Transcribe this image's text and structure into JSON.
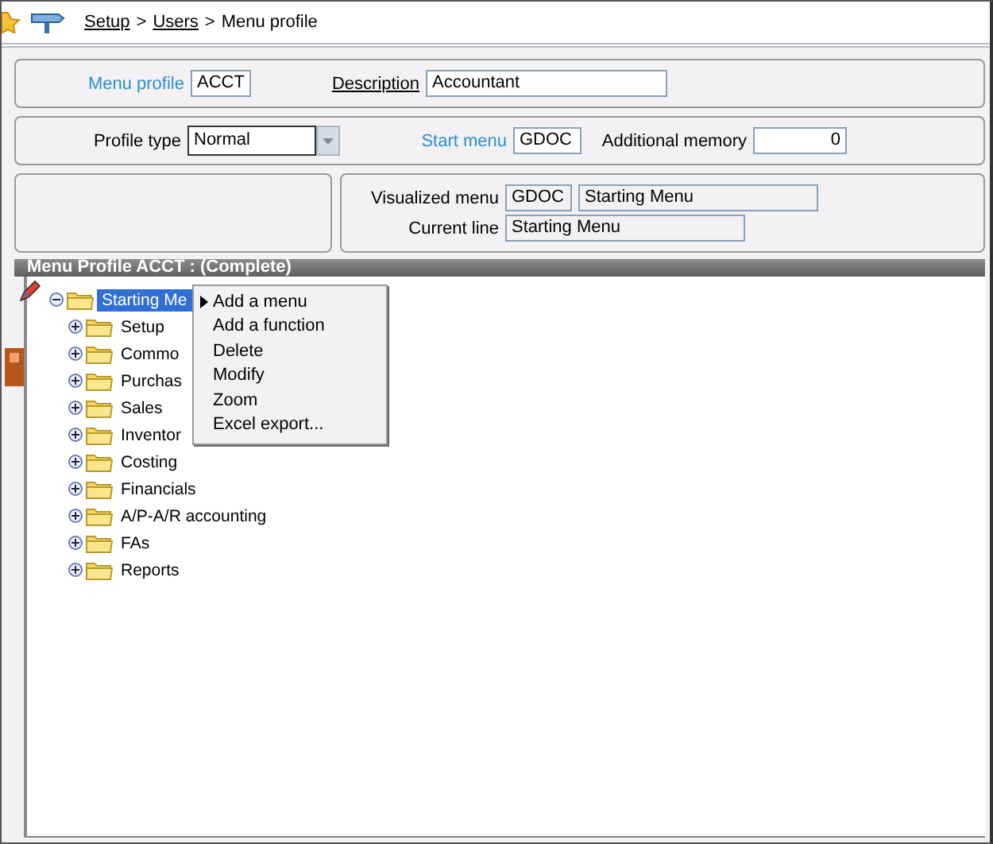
{
  "breadcrumb": [
    {
      "label": "Setup",
      "kind": "link"
    },
    {
      "label": ">",
      "kind": "separator"
    },
    {
      "label": "Users",
      "kind": "link"
    },
    {
      "label": ">",
      "kind": "separator"
    },
    {
      "label": "Menu profile",
      "kind": "current"
    }
  ],
  "header": {
    "menu_profile": {
      "label": "Menu profile",
      "value": "ACCT"
    },
    "description": {
      "label": "Description",
      "value": "Accountant"
    }
  },
  "settings": {
    "profile_type": {
      "label": "Profile type",
      "value": "Normal"
    },
    "start_menu": {
      "label": "Start menu",
      "value": "GDOC"
    },
    "additional_memory": {
      "label": "Additional memory",
      "value": "0"
    }
  },
  "visualized": {
    "visualized_menu": {
      "label": "Visualized menu",
      "code": "GDOC",
      "name": "Starting Menu"
    },
    "current_line": {
      "label": "Current line",
      "value": "Starting Menu"
    }
  },
  "tree_panel": {
    "title": "Menu Profile ACCT : (Complete)",
    "tree": [
      {
        "label": "Starting Me",
        "selected": true,
        "expanded": true,
        "children": [
          {
            "label": "Setup",
            "selected": false,
            "expanded": false
          },
          {
            "label": "Commo",
            "selected": false,
            "expanded": false
          },
          {
            "label": "Purchas",
            "selected": false,
            "expanded": false
          },
          {
            "label": "Sales",
            "selected": false,
            "expanded": false
          },
          {
            "label": "Inventor",
            "selected": false,
            "expanded": false
          },
          {
            "label": "Costing",
            "selected": false,
            "expanded": false
          },
          {
            "label": "Financials",
            "selected": false,
            "expanded": false
          },
          {
            "label": "A/P-A/R accounting",
            "selected": false,
            "expanded": false
          },
          {
            "label": "FAs",
            "selected": false,
            "expanded": false
          },
          {
            "label": "Reports",
            "selected": false,
            "expanded": false
          }
        ]
      }
    ]
  },
  "context_menu": {
    "items": [
      {
        "label": "Add a menu",
        "selected": true
      },
      {
        "label": "Add a function",
        "selected": false
      },
      {
        "label": "Delete",
        "selected": false
      },
      {
        "label": "Modify",
        "selected": false
      },
      {
        "label": "Zoom",
        "selected": false
      },
      {
        "label": "Excel export...",
        "selected": false
      }
    ]
  }
}
